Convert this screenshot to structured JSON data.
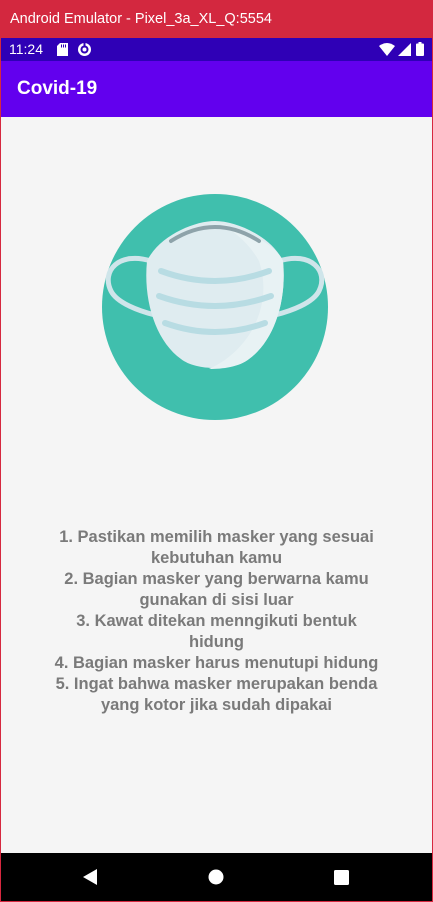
{
  "window": {
    "title": "Android Emulator - Pixel_3a_XL_Q:5554"
  },
  "status_bar": {
    "time": "11:24",
    "icons": [
      "sd-card-icon",
      "sync-icon",
      "wifi-icon",
      "signal-icon",
      "battery-icon"
    ]
  },
  "app_bar": {
    "title": "Covid-19"
  },
  "content": {
    "illustration": "face-mask-icon",
    "instructions": [
      "1. Pastikan memilih masker yang sesuai",
      "kebutuhan kamu",
      "2. Bagian masker yang berwarna kamu",
      "gunakan di sisi luar",
      "3. Kawat ditekan menngikuti bentuk",
      "hidung",
      "4. Bagian masker harus menutupi hidung",
      "5. Ingat bahwa masker merupakan benda",
      "yang kotor jika sudah dipakai"
    ]
  },
  "nav_bar": {
    "buttons": [
      "back-icon",
      "home-icon",
      "recents-icon"
    ]
  },
  "colors": {
    "window_titlebar": "#d3283f",
    "status_bar": "#2f00b6",
    "app_bar": "#6200ee",
    "illustration_circle": "#40bfad",
    "text": "#7a7a7a"
  }
}
